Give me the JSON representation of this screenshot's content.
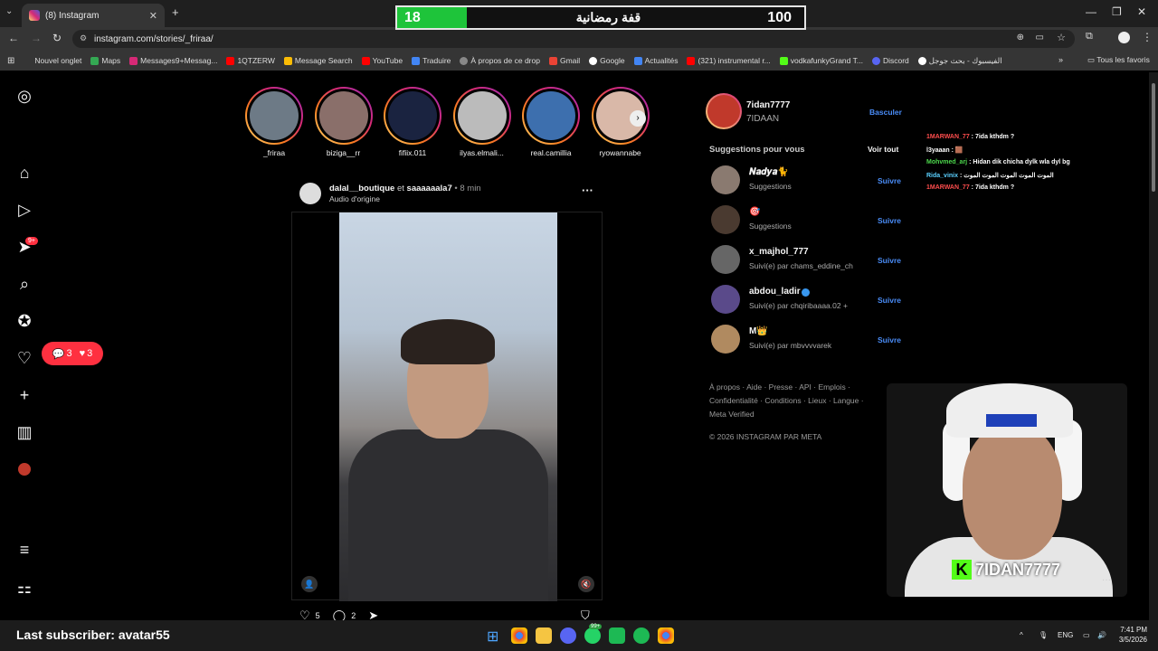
{
  "browser": {
    "tab_title": "(8) Instagram",
    "url": "instagram.com/stories/_friraa/",
    "bookmarks": [
      "Nouvel onglet",
      "Maps",
      "Messages9+Messag...",
      "1QTZERW",
      "Message Search",
      "YouTube",
      "Traduire",
      "À propos de ce drop",
      "Gmail",
      "Google",
      "Actualités",
      "(321) instrumental r...",
      "vodkafunkyGrand T...",
      "Discord",
      "الفيسبوك - بحث جوجل"
    ],
    "all_bookmarks": "Tous les favoris"
  },
  "overlay": {
    "score_left": "18",
    "score_title": "قفة رمضانية",
    "score_right": "100"
  },
  "nav": {
    "notifications_badge": "9+",
    "pill_comments": "3",
    "pill_likes": "3"
  },
  "stories": [
    {
      "name": "_friraa",
      "color": "#6d7a86"
    },
    {
      "name": "biziga__rr",
      "color": "#8a6f6a"
    },
    {
      "name": "fifiix.011",
      "color": "#1a2340"
    },
    {
      "name": "ilyas.elmali...",
      "color": "#bbbbbb"
    },
    {
      "name": "real.camillia",
      "color": "#3d6fae"
    },
    {
      "name": "ryowannabe",
      "color": "#d9b8a8"
    }
  ],
  "post": {
    "user": "dalal__boutique",
    "connector": "et",
    "coauthor": "saaaaaala7",
    "time": "• 8 min",
    "audio": "Audio d'origine",
    "likes": "5",
    "comments": "2"
  },
  "profile": {
    "username": "7idan7777",
    "fullname": "7IDAAN",
    "switch": "Basculer"
  },
  "suggestions": {
    "title": "Suggestions pour vous",
    "see_all": "Voir tout",
    "follow_label": "Suivre",
    "items": [
      {
        "name": "𝑵𝒂𝒅𝒚𝒂🐈",
        "sub": "Suggestions"
      },
      {
        "name": "🎯",
        "sub": "Suggestions"
      },
      {
        "name": "x_majhol_777",
        "sub": "Suivi(e) par chams_eddine_ch"
      },
      {
        "name": "abdou_ladir",
        "sub": "Suivi(e) par chqiribaaaa.02 +"
      },
      {
        "name": "M👑",
        "sub": "Suivi(e) par mbvvvvarek"
      }
    ]
  },
  "footer": {
    "links": "À propos · Aide · Presse · API · Emplois · Confidentialité · Conditions · Lieux · Langue · Meta Verified",
    "copyright": "© 2026 INSTAGRAM PAR META"
  },
  "chat": [
    {
      "user": "1MARWAN_77",
      "msg": "7ida kthdm ?",
      "color": "#ff4d4d"
    },
    {
      "user": "l3yaaan",
      "msg": "🟫",
      "color": "#ffffff"
    },
    {
      "user": "Mohvmed_arj",
      "msg": "Hidan dik chicha dylk wla dyl bg",
      "color": "#4dd94d"
    },
    {
      "user": "Rida_vinix",
      "msg": "الموت الموت الموت الموت الموت",
      "color": "#5ad0ff"
    },
    {
      "user": "1MARWAN_77",
      "msg": "7ida kthdm ?",
      "color": "#ff4d4d"
    }
  ],
  "webcam": {
    "kick_name": "7IDAN7777"
  },
  "stream": {
    "last_subscriber": "Last subscriber: avatar55"
  },
  "taskbar": {
    "lang": "ENG",
    "time": "7:41 PM",
    "date": "3/5/2026",
    "badge": "99+"
  }
}
